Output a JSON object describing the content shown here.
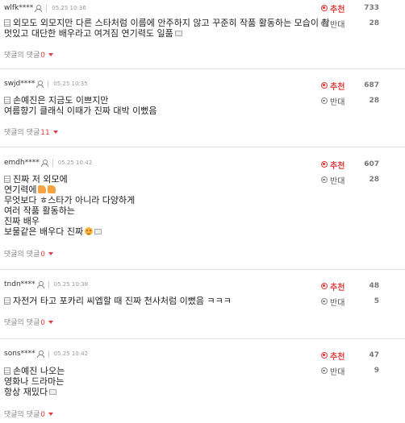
{
  "labels": {
    "upvote": "추천",
    "downvote": "반대",
    "reply_prefix": "댓글의 댓글"
  },
  "colors": {
    "accent": "#e03c3c",
    "meta": "#999999",
    "divider": "#e2e2e2"
  },
  "comments": [
    {
      "nick": "wlfk****",
      "date": "05.25 10:36",
      "lines": [
        "외모도 외모지만 다른 스타처럼 이름에 안주하지 않고 꾸준히 작품 활동하는 모습이 참",
        "멋있고 대단한 배우라고 여겨짐 연기력도 일품"
      ],
      "replies": "0",
      "up": "733",
      "down": "28"
    },
    {
      "nick": "swjd****",
      "date": "05.25 10:35",
      "lines": [
        "손예진은 지금도 이쁘지만",
        "여름향기 클래식 이때가 진짜 대박 이뻤음"
      ],
      "replies": "11",
      "up": "687",
      "down": "28"
    },
    {
      "nick": "emdh****",
      "date": "05.25 10:42",
      "lines": [
        "진짜 저 외모에",
        "연기력에",
        "무엇보다 ㅎ스타가 아니라 다양하게",
        "여러 작품 활동하는",
        "진짜 배우",
        "보물같은 배우다 진짜"
      ],
      "replies": "0",
      "up": "607",
      "down": "28"
    },
    {
      "nick": "tndn****",
      "date": "05.25 10:38",
      "lines": [
        "자전거 타고 포카리 씨엡할 때 진짜 천사처럼 이뻤음 ㅋㅋㅋ"
      ],
      "replies": "0",
      "up": "48",
      "down": "5"
    },
    {
      "nick": "sons****",
      "date": "05.25 10:42",
      "lines": [
        "손예진 나오는",
        "영화나 드라마는",
        "항상 재밌다"
      ],
      "replies": "0",
      "up": "47",
      "down": "9"
    }
  ]
}
